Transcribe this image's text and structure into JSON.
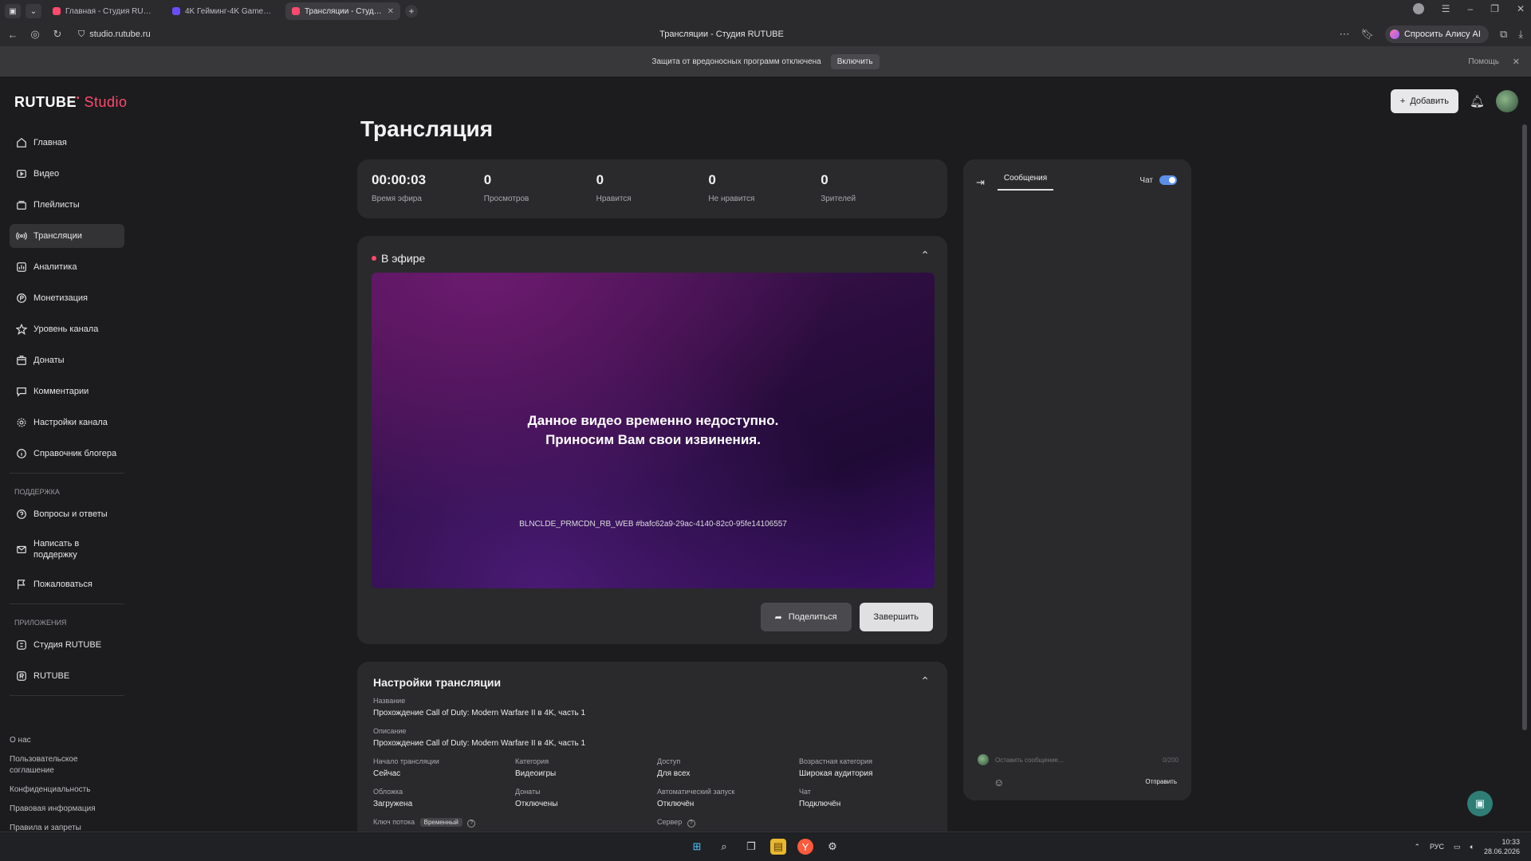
{
  "browser": {
    "tabs": [
      {
        "label": "Главная - Студия RUTUBE",
        "active": false,
        "color": "#ff4a6e"
      },
      {
        "label": "4K Гейминг-4K Games, C",
        "active": false,
        "color": "#6a4cff"
      },
      {
        "label": "Трансляции - Студия RUTUBE",
        "active": true,
        "color": "#ff4a6e"
      }
    ],
    "url": "studio.rutube.ru",
    "page_title": "Трансляции - Студия RUTUBE",
    "alice_label": "Спросить Алису AI",
    "infobar": {
      "message": "Защита от вредоносных программ отключена",
      "enable_label": "Включить",
      "help_label": "Помощь"
    }
  },
  "app": {
    "logo_main": "RUTUBE",
    "logo_studio": "Studio",
    "add_button": "Добавить",
    "page_heading": "Трансляция",
    "sidebar": {
      "items": [
        {
          "label": "Главная",
          "icon": "home-icon"
        },
        {
          "label": "Видео",
          "icon": "video-icon"
        },
        {
          "label": "Плейлисты",
          "icon": "playlist-icon"
        },
        {
          "label": "Трансляции",
          "icon": "broadcast-icon",
          "active": true
        },
        {
          "label": "Аналитика",
          "icon": "analytics-icon"
        },
        {
          "label": "Монетизация",
          "icon": "monetization-icon"
        },
        {
          "label": "Уровень канала",
          "icon": "star-icon"
        },
        {
          "label": "Донаты",
          "icon": "donate-icon"
        },
        {
          "label": "Комментарии",
          "icon": "comment-icon"
        },
        {
          "label": "Настройки канала",
          "icon": "gear-icon"
        },
        {
          "label": "Справочник блогера",
          "icon": "info-icon"
        }
      ],
      "support_heading": "ПОДДЕРЖКА",
      "support_items": [
        {
          "label": "Вопросы и ответы",
          "icon": "question-icon"
        },
        {
          "label": "Написать в поддержку",
          "icon": "mail-icon"
        },
        {
          "label": "Пожаловаться",
          "icon": "flag-icon"
        }
      ],
      "apps_heading": "ПРИЛОЖЕНИЯ",
      "apps_items": [
        {
          "label": "Студия RUTUBE",
          "icon": "studio-app-icon"
        },
        {
          "label": "RUTUBE",
          "icon": "rutube-app-icon"
        }
      ],
      "footer_links": [
        "О нас",
        "Пользовательское соглашение",
        "Конфиденциальность",
        "Правовая информация",
        "Правила и запреты"
      ]
    },
    "stats": [
      {
        "value": "00:00:03",
        "label": "Время эфира"
      },
      {
        "value": "0",
        "label": "Просмотров"
      },
      {
        "value": "0",
        "label": "Нравится"
      },
      {
        "value": "0",
        "label": "Не нравится"
      },
      {
        "value": "0",
        "label": "Зрителей"
      }
    ],
    "live": {
      "title": "В эфире",
      "message_line1": "Данное видео временно недоступно.",
      "message_line2": "Приносим Вам свои извинения.",
      "error_code": "BLNCLDE_PRMCDN_RB_WEB #bafc62a9-29ac-4140-82c0-95fe14106557",
      "share_label": "Поделиться",
      "finish_label": "Завершить"
    },
    "settings": {
      "title": "Настройки трансляции",
      "name_label": "Название",
      "name_value": "Прохождение Call of Duty: Modern Warfare II в 4K, часть 1",
      "desc_label": "Описание",
      "desc_value": "Прохождение Call of Duty: Modern Warfare II в 4K, часть 1",
      "start_label": "Начало трансляции",
      "start_value": "Сейчас",
      "category_label": "Категория",
      "category_value": "Видеоигры",
      "access_label": "Доступ",
      "access_value": "Для всех",
      "age_label": "Возрастная категория",
      "age_value": "Широкая аудитория",
      "cover_label": "Обложка",
      "cover_value": "Загружена",
      "donates_label": "Донаты",
      "donates_value": "Отключены",
      "autostart_label": "Автоматический запуск",
      "autostart_value": "Отключён",
      "chat_label": "Чат",
      "chat_value": "Подключён",
      "key_label": "Ключ потока",
      "key_badge": "Временный",
      "server_label": "Сервер"
    },
    "chat": {
      "tab_label": "Сообщения",
      "toggle_label": "Чат",
      "input_placeholder": "Оставить сообщение...",
      "counter": "0/200",
      "send_label": "Отправить"
    }
  },
  "taskbar": {
    "lang": "РУС",
    "time": "10:33",
    "date": "28.06.2026"
  }
}
